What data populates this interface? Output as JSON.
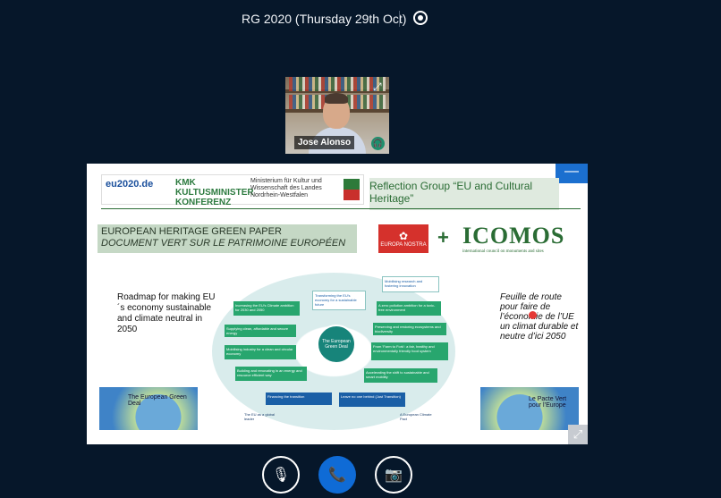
{
  "header": {
    "title": "RG 2020 (Thursday 29th Oct)"
  },
  "participant": {
    "name": "Jose Alonso"
  },
  "slide": {
    "reflection_group": "Reflection Group “EU and Cultural Heritage”",
    "green_paper_line1": "EUROPEAN HERITAGE GREEN PAPER",
    "green_paper_line2": "DOCUMENT VERT SUR LE PATRIMOINE EUROPÉEN",
    "icomos": "ICOMOS",
    "icomos_sub": "international council on monuments and sites",
    "eu2020": "eu2020.de",
    "kmk": "KMK KULTUSMINISTER KONFERENZ",
    "nrw": "Ministerium für Kultur und Wissenschaft des Landes Nordrhein-Westfalen",
    "europa_nostra": "EUROPA NOSTRA",
    "roadmap": "Roadmap for making EU´s economy sustainable and climate neutral in 2050",
    "feuille": "Feuille de route pour faire de l’économie de l’UE un climat durable et neutre d’ici 2050",
    "green_deal_en": "The European Green Deal",
    "green_deal_fr": "Le Pacte Vert pour l’Europe",
    "center": "The European Green Deal",
    "boxes": {
      "transforming": "Transforming the EU's economy for a sustainable future",
      "mobilising_research": "Mobilising research and fostering innovation",
      "increasing_ambition": "Increasing the EU's Climate ambition for 2030 and 2050",
      "zero_pollution": "A zero pollution ambition for a toxic-free environment",
      "clean_energy": "Supplying clean, affordable and secure energy",
      "ecosystems": "Preserving and restoring ecosystems and biodiversity",
      "industry": "Mobilising industry for a clean and circular economy",
      "farm_to_fork": "From 'Farm to Fork': a fair, healthy and environmentally friendly food system",
      "building": "Building and renovating in an energy and resource efficient way",
      "mobility": "Accelerating the shift to sustainable and smart mobility",
      "financing": "Financing the transition",
      "leave_no_one": "Leave no one behind (Just Transition)",
      "global_leader": "The EU as a global leader",
      "climate_pact": "A European Climate Pact"
    }
  },
  "controls": {
    "mute_icon": "microphone-off-icon",
    "hangup_icon": "phone-icon",
    "video_icon": "camera-off-icon"
  }
}
